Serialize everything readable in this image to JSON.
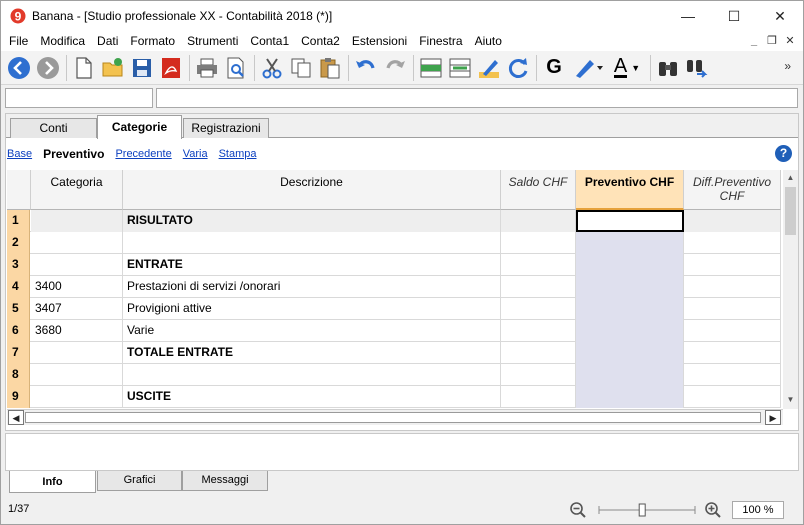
{
  "window": {
    "title": "Banana - [Studio professionale XX - Contabilità 2018 (*)]",
    "controls": {
      "minimize": "—",
      "maximize": "☐",
      "close": "✕"
    }
  },
  "menu": [
    "File",
    "Modifica",
    "Dati",
    "Formato",
    "Strumenti",
    "Conta1",
    "Conta2",
    "Estensioni",
    "Finestra",
    "Aiuto"
  ],
  "toolbar": {
    "icons": [
      "back-icon",
      "forward-icon",
      "new-file-icon",
      "open-file-icon",
      "save-icon",
      "pdf-icon",
      "print-icon",
      "print-preview-icon",
      "cut-icon",
      "copy-icon",
      "paste-icon",
      "undo-icon",
      "redo-icon",
      "insert-rows-icon",
      "delete-rows-icon",
      "edit-icon",
      "recheck-icon",
      "bold-icon",
      "highlight-icon",
      "font-color-icon",
      "find-icon",
      "find-next-icon"
    ],
    "bold_label": "G",
    "font_color_label": "A",
    "more": "»"
  },
  "tabs": [
    {
      "label": "Conti",
      "active": false
    },
    {
      "label": "Categorie",
      "active": true
    },
    {
      "label": "Registrazioni",
      "active": false
    }
  ],
  "views": [
    {
      "label": "Base",
      "active": false
    },
    {
      "label": "Preventivo",
      "active": true
    },
    {
      "label": "Precedente",
      "active": false
    },
    {
      "label": "Varia",
      "active": false
    },
    {
      "label": "Stampa",
      "active": false
    }
  ],
  "help": "?",
  "table": {
    "columns": [
      "Categoria",
      "Descrizione",
      "Saldo CHF",
      "Preventivo CHF",
      "Diff.Preventivo CHF"
    ],
    "rows": [
      {
        "num": "1",
        "categoria": "",
        "descrizione": "RISULTATO",
        "bold": true
      },
      {
        "num": "2",
        "categoria": "",
        "descrizione": "",
        "bold": false
      },
      {
        "num": "3",
        "categoria": "",
        "descrizione": "ENTRATE",
        "bold": true
      },
      {
        "num": "4",
        "categoria": "3400",
        "descrizione": "Prestazioni di servizi /onorari",
        "bold": false
      },
      {
        "num": "5",
        "categoria": "3407",
        "descrizione": "Provigioni attive",
        "bold": false
      },
      {
        "num": "6",
        "categoria": "3680",
        "descrizione": "Varie",
        "bold": false
      },
      {
        "num": "7",
        "categoria": "",
        "descrizione": "TOTALE ENTRATE",
        "bold": true
      },
      {
        "num": "8",
        "categoria": "",
        "descrizione": "",
        "bold": false
      },
      {
        "num": "9",
        "categoria": "",
        "descrizione": "USCITE",
        "bold": true
      }
    ]
  },
  "scroll": {
    "left": "◀",
    "right": "▶",
    "up": "▲",
    "down": "▼"
  },
  "bottom_tabs": [
    {
      "label": "Info",
      "active": true
    },
    {
      "label": "Grafici",
      "active": false
    },
    {
      "label": "Messaggi",
      "active": false
    }
  ],
  "status": {
    "page_count": "1/37",
    "zoom": "100 %",
    "zoom_level_pct": 45
  }
}
